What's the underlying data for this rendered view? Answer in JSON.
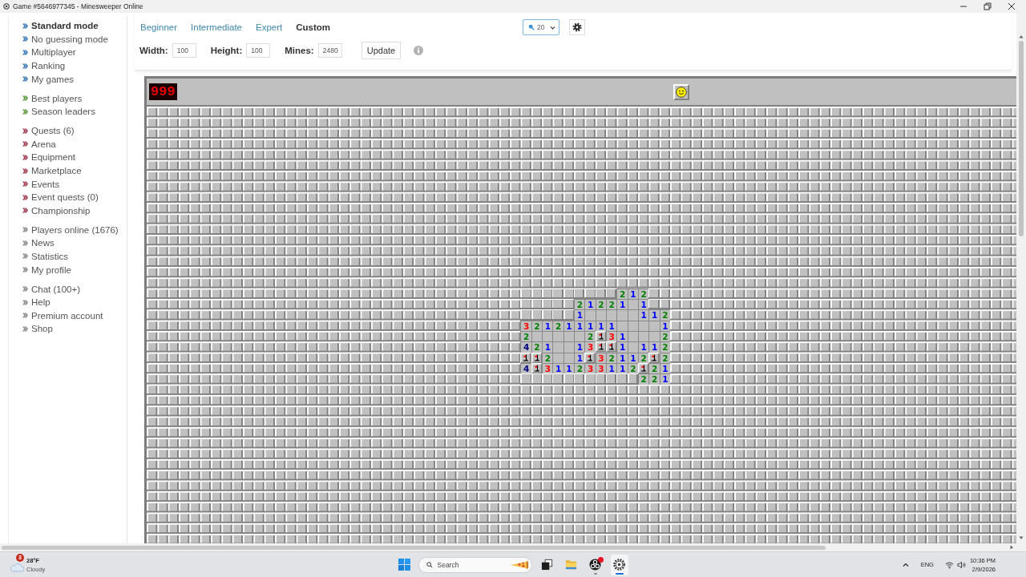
{
  "window": {
    "title": "Game #5646977345 - Minesweeper Online"
  },
  "sidebar": {
    "groups": [
      {
        "color": "#3d7ab8",
        "items": [
          {
            "label": "Standard mode",
            "selected": true
          },
          {
            "label": "No guessing mode",
            "selected": false
          },
          {
            "label": "Multiplayer",
            "selected": false
          },
          {
            "label": "Ranking",
            "selected": false
          },
          {
            "label": "My games",
            "selected": false
          }
        ]
      },
      {
        "color": "#5b9a3c",
        "items": [
          {
            "label": "Best players",
            "selected": false
          },
          {
            "label": "Season leaders",
            "selected": false
          }
        ]
      },
      {
        "color": "#a33a4f",
        "items": [
          {
            "label": "Quests (6)",
            "selected": false
          },
          {
            "label": "Arena",
            "selected": false
          },
          {
            "label": "Equipment",
            "selected": false
          },
          {
            "label": "Marketplace",
            "selected": false
          },
          {
            "label": "Events",
            "selected": false
          },
          {
            "label": "Event quests (0)",
            "selected": false
          },
          {
            "label": "Championship",
            "selected": false
          }
        ]
      },
      {
        "color": "#8a8a8a",
        "items": [
          {
            "label": "Players online (1676)",
            "selected": false
          },
          {
            "label": "News",
            "selected": false
          },
          {
            "label": "Statistics",
            "selected": false
          },
          {
            "label": "My profile",
            "selected": false
          }
        ]
      },
      {
        "color": "#8a8a8a",
        "items": [
          {
            "label": "Chat (100+)",
            "selected": false
          },
          {
            "label": "Help",
            "selected": false
          },
          {
            "label": "Premium account",
            "selected": false
          },
          {
            "label": "Shop",
            "selected": false
          }
        ]
      }
    ]
  },
  "difficulty_tabs": [
    {
      "label": "Beginner",
      "selected": false
    },
    {
      "label": "Intermediate",
      "selected": false
    },
    {
      "label": "Expert",
      "selected": false
    },
    {
      "label": "Custom",
      "selected": true
    }
  ],
  "zoom_select": {
    "value": "20"
  },
  "custom_fields": [
    {
      "label": "Width:",
      "value": "100"
    },
    {
      "label": "Height:",
      "value": "100"
    },
    {
      "label": "Mines:",
      "value": "2480"
    }
  ],
  "update_button": {
    "label": "Update"
  },
  "game": {
    "mine_counter": "999",
    "minefield": {
      "revealed_area": [
        [
          {
            "kind": "closed"
          },
          {
            "kind": "closed"
          },
          {
            "kind": "closed"
          },
          {
            "kind": "closed"
          },
          {
            "kind": "closed"
          },
          {
            "kind": "closed"
          },
          {
            "kind": "closed"
          },
          {
            "kind": "closed"
          },
          {
            "kind": "closed"
          },
          {
            "kind": "number",
            "label": "2",
            "color": "#008000"
          },
          {
            "kind": "number",
            "label": "1",
            "color": "#0000ff"
          },
          {
            "kind": "number",
            "label": "2",
            "color": "#008000"
          },
          {
            "kind": "closed"
          },
          {
            "kind": "closed"
          }
        ],
        [
          {
            "kind": "closed"
          },
          {
            "kind": "closed"
          },
          {
            "kind": "closed"
          },
          {
            "kind": "closed"
          },
          {
            "kind": "closed"
          },
          {
            "kind": "number",
            "label": "2",
            "color": "#008000"
          },
          {
            "kind": "number",
            "label": "1",
            "color": "#0000ff"
          },
          {
            "kind": "number",
            "label": "2",
            "color": "#008000"
          },
          {
            "kind": "number",
            "label": "2",
            "color": "#008000"
          },
          {
            "kind": "number",
            "label": "1",
            "color": "#0000ff"
          },
          {
            "kind": "open"
          },
          {
            "kind": "number",
            "label": "1",
            "color": "#0000ff"
          },
          {
            "kind": "closed"
          },
          {
            "kind": "closed"
          }
        ],
        [
          {
            "kind": "closed"
          },
          {
            "kind": "closed"
          },
          {
            "kind": "closed"
          },
          {
            "kind": "closed"
          },
          {
            "kind": "closed"
          },
          {
            "kind": "number",
            "label": "1",
            "color": "#0000ff"
          },
          {
            "kind": "open"
          },
          {
            "kind": "open"
          },
          {
            "kind": "open"
          },
          {
            "kind": "open"
          },
          {
            "kind": "open"
          },
          {
            "kind": "number",
            "label": "1",
            "color": "#0000ff"
          },
          {
            "kind": "number",
            "label": "1",
            "color": "#0000ff"
          },
          {
            "kind": "number",
            "label": "2",
            "color": "#008000"
          }
        ],
        [
          {
            "kind": "number",
            "label": "3",
            "color": "#ff0000"
          },
          {
            "kind": "number",
            "label": "2",
            "color": "#008000"
          },
          {
            "kind": "number",
            "label": "1",
            "color": "#0000ff"
          },
          {
            "kind": "number",
            "label": "2",
            "color": "#008000"
          },
          {
            "kind": "number",
            "label": "1",
            "color": "#0000ff"
          },
          {
            "kind": "number",
            "label": "1",
            "color": "#0000ff"
          },
          {
            "kind": "number",
            "label": "1",
            "color": "#0000ff"
          },
          {
            "kind": "number",
            "label": "1",
            "color": "#0000ff"
          },
          {
            "kind": "number",
            "label": "1",
            "color": "#0000ff"
          },
          {
            "kind": "open"
          },
          {
            "kind": "open"
          },
          {
            "kind": "open"
          },
          {
            "kind": "open"
          },
          {
            "kind": "number",
            "label": "1",
            "color": "#0000ff"
          }
        ],
        [
          {
            "kind": "number",
            "label": "2",
            "color": "#008000"
          },
          {
            "kind": "open"
          },
          {
            "kind": "open"
          },
          {
            "kind": "open"
          },
          {
            "kind": "open"
          },
          {
            "kind": "open"
          },
          {
            "kind": "number",
            "label": "2",
            "color": "#008000"
          },
          {
            "kind": "flag"
          },
          {
            "kind": "number",
            "label": "3",
            "color": "#ff0000"
          },
          {
            "kind": "number",
            "label": "1",
            "color": "#0000ff"
          },
          {
            "kind": "open"
          },
          {
            "kind": "open"
          },
          {
            "kind": "open"
          },
          {
            "kind": "number",
            "label": "2",
            "color": "#008000"
          }
        ],
        [
          {
            "kind": "number",
            "label": "4",
            "color": "#000080"
          },
          {
            "kind": "number",
            "label": "2",
            "color": "#008000"
          },
          {
            "kind": "number",
            "label": "1",
            "color": "#0000ff"
          },
          {
            "kind": "open"
          },
          {
            "kind": "open"
          },
          {
            "kind": "number",
            "label": "1",
            "color": "#0000ff"
          },
          {
            "kind": "number",
            "label": "3",
            "color": "#ff0000"
          },
          {
            "kind": "flag"
          },
          {
            "kind": "flag"
          },
          {
            "kind": "number",
            "label": "1",
            "color": "#0000ff"
          },
          {
            "kind": "open"
          },
          {
            "kind": "number",
            "label": "1",
            "color": "#0000ff"
          },
          {
            "kind": "number",
            "label": "1",
            "color": "#0000ff"
          },
          {
            "kind": "number",
            "label": "2",
            "color": "#008000"
          }
        ],
        [
          {
            "kind": "flag"
          },
          {
            "kind": "flag"
          },
          {
            "kind": "number",
            "label": "2",
            "color": "#008000"
          },
          {
            "kind": "open"
          },
          {
            "kind": "open"
          },
          {
            "kind": "number",
            "label": "1",
            "color": "#0000ff"
          },
          {
            "kind": "flag"
          },
          {
            "kind": "number",
            "label": "3",
            "color": "#ff0000"
          },
          {
            "kind": "number",
            "label": "2",
            "color": "#008000"
          },
          {
            "kind": "number",
            "label": "1",
            "color": "#0000ff"
          },
          {
            "kind": "number",
            "label": "1",
            "color": "#0000ff"
          },
          {
            "kind": "number",
            "label": "2",
            "color": "#008000"
          },
          {
            "kind": "flag"
          },
          {
            "kind": "number",
            "label": "2",
            "color": "#008000"
          }
        ],
        [
          {
            "kind": "number",
            "label": "4",
            "color": "#000080"
          },
          {
            "kind": "flag"
          },
          {
            "kind": "number",
            "label": "3",
            "color": "#ff0000"
          },
          {
            "kind": "number",
            "label": "1",
            "color": "#0000ff"
          },
          {
            "kind": "number",
            "label": "1",
            "color": "#0000ff"
          },
          {
            "kind": "number",
            "label": "2",
            "color": "#008000"
          },
          {
            "kind": "number",
            "label": "3",
            "color": "#ff0000"
          },
          {
            "kind": "number",
            "label": "3",
            "color": "#ff0000"
          },
          {
            "kind": "number",
            "label": "1",
            "color": "#0000ff"
          },
          {
            "kind": "number",
            "label": "1",
            "color": "#0000ff"
          },
          {
            "kind": "number",
            "label": "2",
            "color": "#008000"
          },
          {
            "kind": "flag"
          },
          {
            "kind": "number",
            "label": "2",
            "color": "#008000"
          },
          {
            "kind": "number",
            "label": "1",
            "color": "#0000ff"
          }
        ],
        [
          {
            "kind": "closed"
          },
          {
            "kind": "closed"
          },
          {
            "kind": "closed"
          },
          {
            "kind": "closed"
          },
          {
            "kind": "closed"
          },
          {
            "kind": "closed"
          },
          {
            "kind": "closed"
          },
          {
            "kind": "closed"
          },
          {
            "kind": "closed"
          },
          {
            "kind": "closed"
          },
          {
            "kind": "closed"
          },
          {
            "kind": "number",
            "label": "2",
            "color": "#008000"
          },
          {
            "kind": "number",
            "label": "2",
            "color": "#008000"
          },
          {
            "kind": "number",
            "label": "1",
            "color": "#0000ff"
          }
        ]
      ]
    }
  },
  "taskbar": {
    "weather": {
      "alerts": "3",
      "temperature": "28°F",
      "condition": "Cloudy"
    },
    "search": {
      "placeholder": "Search"
    },
    "apps": [
      {
        "kind": "taskview",
        "selected": false,
        "running": false,
        "notification": false
      },
      {
        "kind": "folder",
        "selected": false,
        "running": false,
        "notification": false
      },
      {
        "kind": "disc",
        "selected": false,
        "running": true,
        "notification": true
      },
      {
        "kind": "gear",
        "selected": true,
        "running": true,
        "notification": false
      }
    ],
    "tray": {
      "language": "ENG",
      "time": "10:36 PM",
      "date": "2/9/2026"
    }
  }
}
